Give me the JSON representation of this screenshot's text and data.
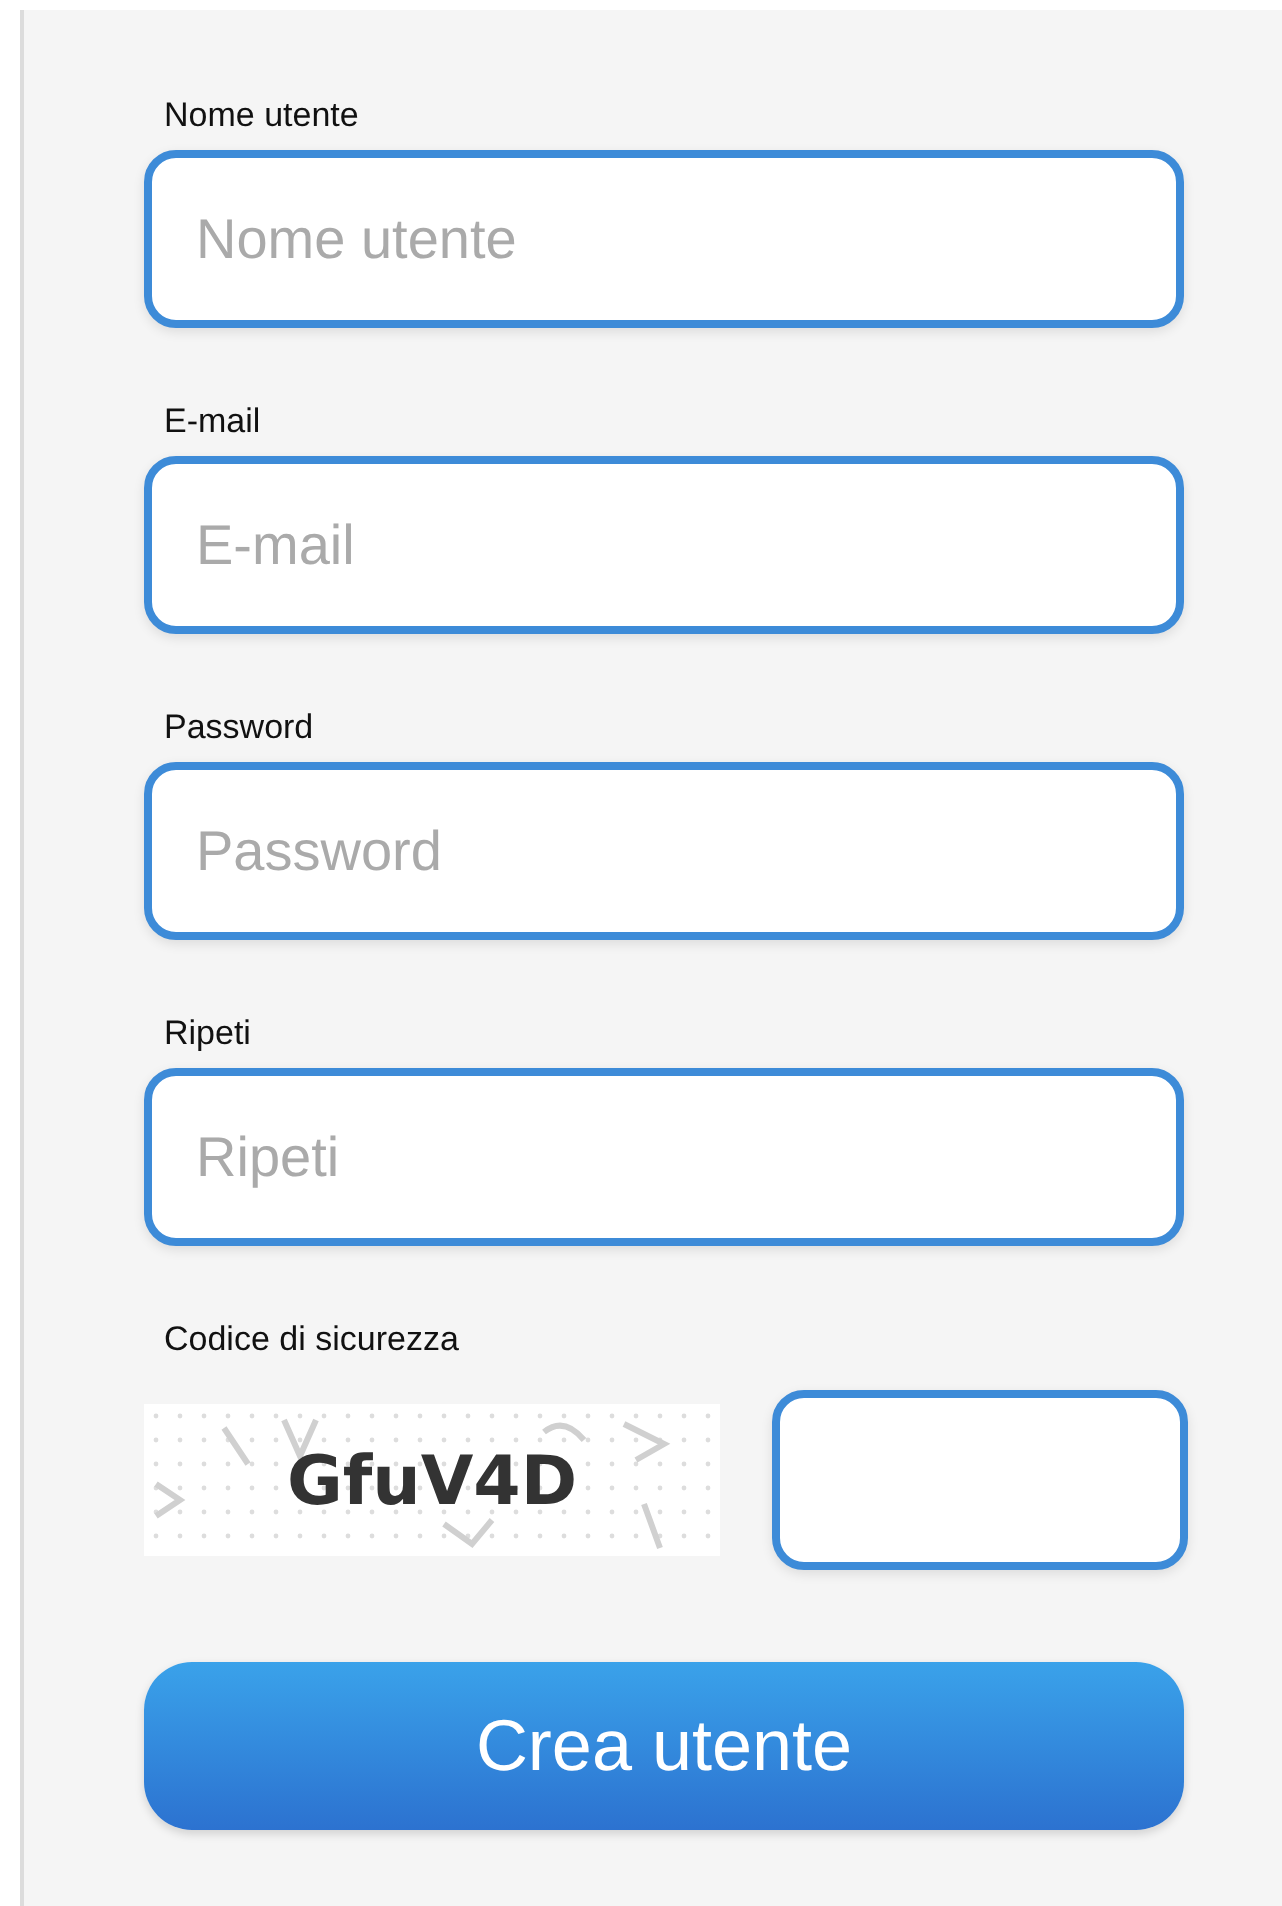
{
  "fields": [
    {
      "label": "Nome utente",
      "placeholder": "Nome utente"
    },
    {
      "label": "E-mail",
      "placeholder": "E-mail"
    },
    {
      "label": "Password",
      "placeholder": "Password"
    },
    {
      "label": "Ripeti",
      "placeholder": "Ripeti"
    }
  ],
  "captcha": {
    "label": "Codice di sicurezza",
    "code": "GfuV4D"
  },
  "submit": {
    "label": "Crea utente"
  }
}
